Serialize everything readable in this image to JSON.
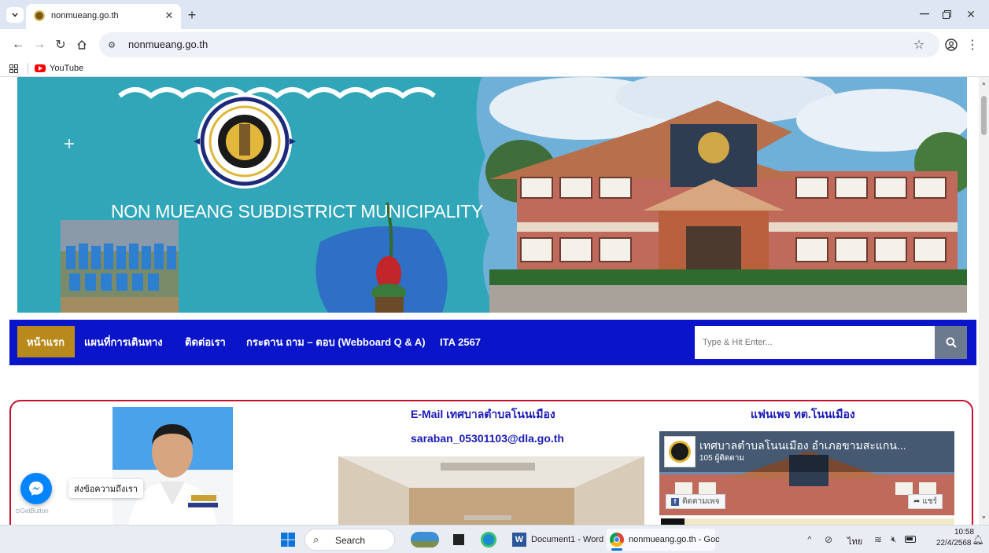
{
  "browser": {
    "tab_title": "nonmueang.go.th",
    "url": "nonmueang.go.th",
    "bookmark_youtube": "YouTube"
  },
  "hero": {
    "heading": "NON MUEANG SUBDISTRICT MUNICIPALITY"
  },
  "nav": {
    "items": [
      {
        "label": "หน้าแรก"
      },
      {
        "label": "แผนที่การเดินทาง"
      },
      {
        "label": "ติดต่อเรา"
      },
      {
        "label": "กระดาน ถาม – ตอบ (Webboard Q & A)"
      },
      {
        "label": "ITA 2567"
      }
    ],
    "search_placeholder": "Type & Hit Enter..."
  },
  "content": {
    "email_heading": "E-Mail เทศบาลตำบลโนนเมือง",
    "email_address": "saraban_05301103@dla.go.th",
    "fanpage_heading": "แฟนเพจ ทต.โนนเมือง",
    "fb_page_name": "เทศบาลตำบลโนนเมือง อำเภอขามสะแกน...",
    "fb_followers": "105 ผู้ติดตาม",
    "fb_follow": "ติดตามเพจ",
    "fb_share": "แชร์"
  },
  "chat": {
    "label": "ส่งข้อความถึงเรา",
    "brand": "GetButton"
  },
  "taskbar": {
    "search": "Search",
    "word_app": "Document1 - Word",
    "chrome_app": "nonmueang.go.th - Goc",
    "lang": "ไทย",
    "time": "10:58",
    "date": "22/4/2568"
  },
  "colors": {
    "nav_bg": "#0a14c9",
    "nav_active": "#b88a1c",
    "panel_border": "#c8102e",
    "heading_blue": "#1a1ab8",
    "hero_teal": "#30a6b8"
  }
}
